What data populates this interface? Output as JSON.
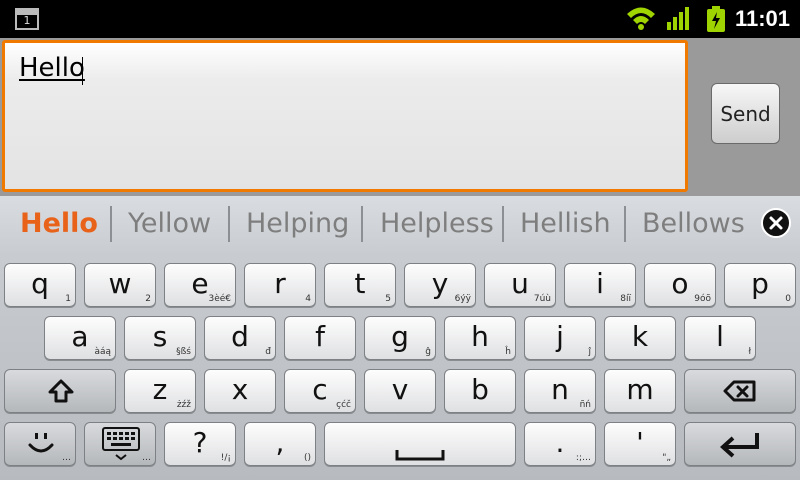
{
  "status_bar": {
    "notification_badge": "1",
    "time": "11:01",
    "icons": [
      "wifi-icon",
      "signal-icon",
      "battery-charging-icon"
    ],
    "colors": {
      "icons": "#9fd400"
    }
  },
  "compose": {
    "text_value": "Hello",
    "send_label": "Send",
    "accent": "#f07a00"
  },
  "suggestions": {
    "items": [
      "Hello",
      "Yellow",
      "Helping",
      "Helpless",
      "Hellish",
      "Bellows"
    ],
    "close_icon": "close-circle-icon"
  },
  "keyboard": {
    "row1": [
      {
        "label": "q",
        "sub": "1"
      },
      {
        "label": "w",
        "sub": "2"
      },
      {
        "label": "e",
        "sub": "3èé€"
      },
      {
        "label": "r",
        "sub": "4"
      },
      {
        "label": "t",
        "sub": "5"
      },
      {
        "label": "y",
        "sub": "6ýÿ"
      },
      {
        "label": "u",
        "sub": "7úù"
      },
      {
        "label": "i",
        "sub": "8íï"
      },
      {
        "label": "o",
        "sub": "9óõ"
      },
      {
        "label": "p",
        "sub": "0"
      }
    ],
    "row2": [
      {
        "label": "a",
        "sub": "àáą"
      },
      {
        "label": "s",
        "sub": "§ßś"
      },
      {
        "label": "d",
        "sub": "đ"
      },
      {
        "label": "f",
        "sub": ""
      },
      {
        "label": "g",
        "sub": "ĝ"
      },
      {
        "label": "h",
        "sub": "ĥ"
      },
      {
        "label": "j",
        "sub": "ĵ"
      },
      {
        "label": "k",
        "sub": ""
      },
      {
        "label": "l",
        "sub": "ł"
      }
    ],
    "row3": [
      {
        "label": "z",
        "sub": "żźž"
      },
      {
        "label": "x",
        "sub": ""
      },
      {
        "label": "c",
        "sub": "çćč"
      },
      {
        "label": "v",
        "sub": ""
      },
      {
        "label": "b",
        "sub": ""
      },
      {
        "label": "n",
        "sub": "ñń"
      },
      {
        "label": "m",
        "sub": ""
      }
    ],
    "row4": {
      "question": {
        "label": "?",
        "sub": "!/¡"
      },
      "comma": {
        "label": ",",
        "sub": "()"
      },
      "period": {
        "label": ".",
        "sub": ":;…"
      },
      "apostrophe": {
        "label": "'",
        "sub": "\"„"
      },
      "emoji_sub": "…",
      "settings_sub": "…"
    },
    "icons": {
      "shift": "shift-arrow-icon",
      "backspace": "backspace-icon",
      "emoji": "smiley-icon",
      "keyboard": "keyboard-settings-icon",
      "space": "space-bar-icon",
      "enter": "enter-arrow-icon"
    }
  }
}
